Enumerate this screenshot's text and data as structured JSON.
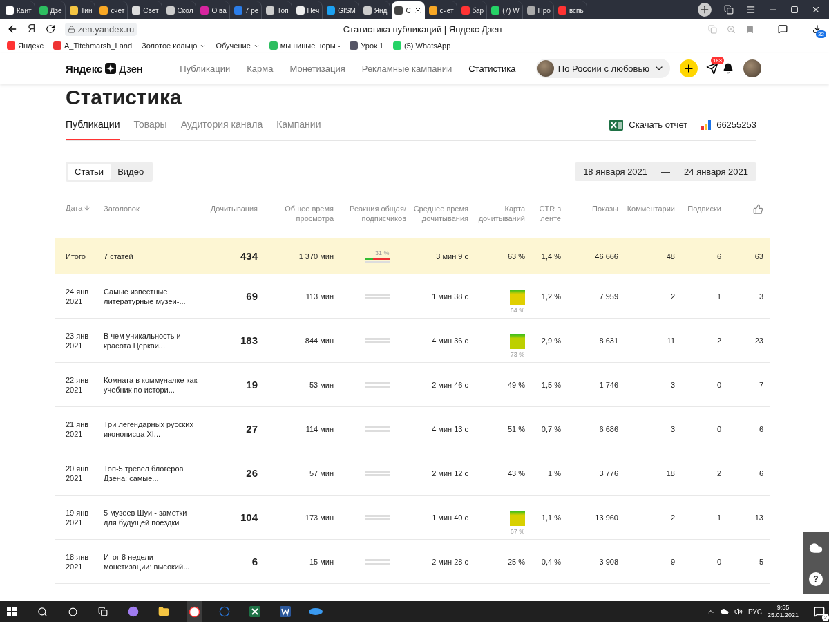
{
  "browser": {
    "tabs": [
      {
        "label": "Кант",
        "selected": false
      },
      {
        "label": "Дзе",
        "selected": false
      },
      {
        "label": "Тин",
        "selected": false
      },
      {
        "label": "счет",
        "selected": false
      },
      {
        "label": "Свет",
        "selected": false
      },
      {
        "label": "Скол",
        "selected": false
      },
      {
        "label": "О ва",
        "selected": false
      },
      {
        "label": "7 ре",
        "selected": false
      },
      {
        "label": "Топ",
        "selected": false
      },
      {
        "label": "Печ",
        "selected": false
      },
      {
        "label": "GISM",
        "selected": false
      },
      {
        "label": "Янд",
        "selected": false
      },
      {
        "label": "С",
        "selected": true
      },
      {
        "label": "счет",
        "selected": false
      },
      {
        "label": "бар",
        "selected": false
      },
      {
        "label": "(7) W",
        "selected": false
      },
      {
        "label": "Про",
        "selected": false
      },
      {
        "label": "вспь",
        "selected": false
      }
    ],
    "home_button": "Я",
    "address": "zen.yandex.ru",
    "page_title": "Статистика публикаций | Яндекс Дзен",
    "downloads_badge": "32",
    "bookmarks": [
      {
        "label": "Яндекс",
        "dropdown": false
      },
      {
        "label": "A_Titchmarsh_Land",
        "dropdown": false
      },
      {
        "label": "Золотое кольцо",
        "dropdown": true
      },
      {
        "label": "Обучение",
        "dropdown": true
      },
      {
        "label": "мышиные норы -",
        "dropdown": false
      },
      {
        "label": "Урок 1",
        "dropdown": false
      },
      {
        "label": "(5) WhatsApp",
        "dropdown": false
      }
    ]
  },
  "site": {
    "logo_left": "Яндекс",
    "logo_right": "Дзен",
    "nav": [
      {
        "label": "Публикации",
        "selected": false
      },
      {
        "label": "Карма",
        "selected": false
      },
      {
        "label": "Монетизация",
        "selected": false
      },
      {
        "label": "Рекламные кампании",
        "selected": false
      },
      {
        "label": "Статистика",
        "selected": true
      }
    ],
    "channel": "По России с любовью",
    "messages_badge": "163"
  },
  "page_title": "Статистика",
  "tabs": [
    {
      "label": "Публикации",
      "selected": true
    },
    {
      "label": "Товары",
      "selected": false
    },
    {
      "label": "Аудитория канала",
      "selected": false
    },
    {
      "label": "Кампании",
      "selected": false
    }
  ],
  "download_report": "Скачать отчет",
  "counter_id": "66255253",
  "content_type": [
    {
      "label": "Статьи",
      "selected": true
    },
    {
      "label": "Видео",
      "selected": false
    }
  ],
  "date_range": {
    "from": "18 января 2021",
    "separator": "—",
    "to": "24 января 2021"
  },
  "table": {
    "columns": [
      "Дата",
      "Заголовок",
      "Дочитывания",
      "Общее время просмотра",
      "Реакция общая/ подписчиков",
      "Среднее время дочитывания",
      "Карта дочитываний",
      "CTR в ленте",
      "Показы",
      "Комментарии",
      "Подписки"
    ],
    "total": {
      "date": "Итого",
      "title": "7 статей",
      "reads": "434",
      "total_time": "1 370 мин",
      "reaction": {
        "level": 0.35,
        "reading": "31 %"
      },
      "avg_time": "3 мин 9 с",
      "map": {
        "kind": "text",
        "reading": "63 %"
      },
      "ctr": "1,4 %",
      "views": "46 666",
      "comments": "48",
      "subscriptions": "6",
      "likes": "63"
    },
    "rows": [
      {
        "date": "24 янв 2021",
        "title": "Самые известные литературные музеи-...",
        "reads": "69",
        "total_time": "113 мин",
        "avg_time": "1 мин 38 с",
        "map": {
          "kind": "square",
          "reading": "64 %",
          "color": "#e0cf00"
        },
        "ctr": "1,2 %",
        "views": "7 959",
        "comments": "2",
        "subscriptions": "1",
        "likes": "3"
      },
      {
        "date": "23 янв 2021",
        "title": "В чем уникальность и красота Церкви...",
        "reads": "183",
        "total_time": "844 мин",
        "avg_time": "4 мин 36 с",
        "map": {
          "kind": "square",
          "reading": "73 %",
          "color": "#bdd000"
        },
        "ctr": "2,9 %",
        "views": "8 631",
        "comments": "11",
        "subscriptions": "2",
        "likes": "23"
      },
      {
        "date": "22 янв 2021",
        "title": "Комната в коммуналке как учебник по истори...",
        "reads": "19",
        "total_time": "53 мин",
        "avg_time": "2 мин 46 с",
        "map": {
          "kind": "text",
          "reading": "49 %"
        },
        "ctr": "1,5 %",
        "views": "1 746",
        "comments": "3",
        "subscriptions": "0",
        "likes": "7"
      },
      {
        "date": "21 янв 2021",
        "title": "Три легендарных русских иконописца XI...",
        "reads": "27",
        "total_time": "114 мин",
        "avg_time": "4 мин 13 с",
        "map": {
          "kind": "text",
          "reading": "51 %"
        },
        "ctr": "0,7 %",
        "views": "6 686",
        "comments": "3",
        "subscriptions": "0",
        "likes": "6"
      },
      {
        "date": "20 янв 2021",
        "title": "Топ-5 тревел блогеров Дзена: самые...",
        "reads": "26",
        "total_time": "57 мин",
        "avg_time": "2 мин 12 с",
        "map": {
          "kind": "text",
          "reading": "43 %"
        },
        "ctr": "1 %",
        "views": "3 776",
        "comments": "18",
        "subscriptions": "2",
        "likes": "6"
      },
      {
        "date": "19 янв 2021",
        "title": "5 музеев Шуи - заметки для будущей поездки",
        "reads": "104",
        "total_time": "173 мин",
        "avg_time": "1 мин 40 с",
        "map": {
          "kind": "square",
          "reading": "67 %",
          "color": "#d8d000"
        },
        "ctr": "1,1 %",
        "views": "13 960",
        "comments": "2",
        "subscriptions": "1",
        "likes": "13"
      },
      {
        "date": "18 янв 2021",
        "title": "Итог 8 недели монетизации: высокий...",
        "reads": "6",
        "total_time": "15 мин",
        "avg_time": "2 мин 28 с",
        "map": {
          "kind": "text",
          "reading": "25 %"
        },
        "ctr": "0,4 %",
        "views": "3 908",
        "comments": "9",
        "subscriptions": "0",
        "likes": "5"
      }
    ]
  },
  "help_widget": "?",
  "taskbar": {
    "language": "РУС",
    "time": "9:55",
    "date": "25.01.2021",
    "notifications_badge": "2"
  }
}
